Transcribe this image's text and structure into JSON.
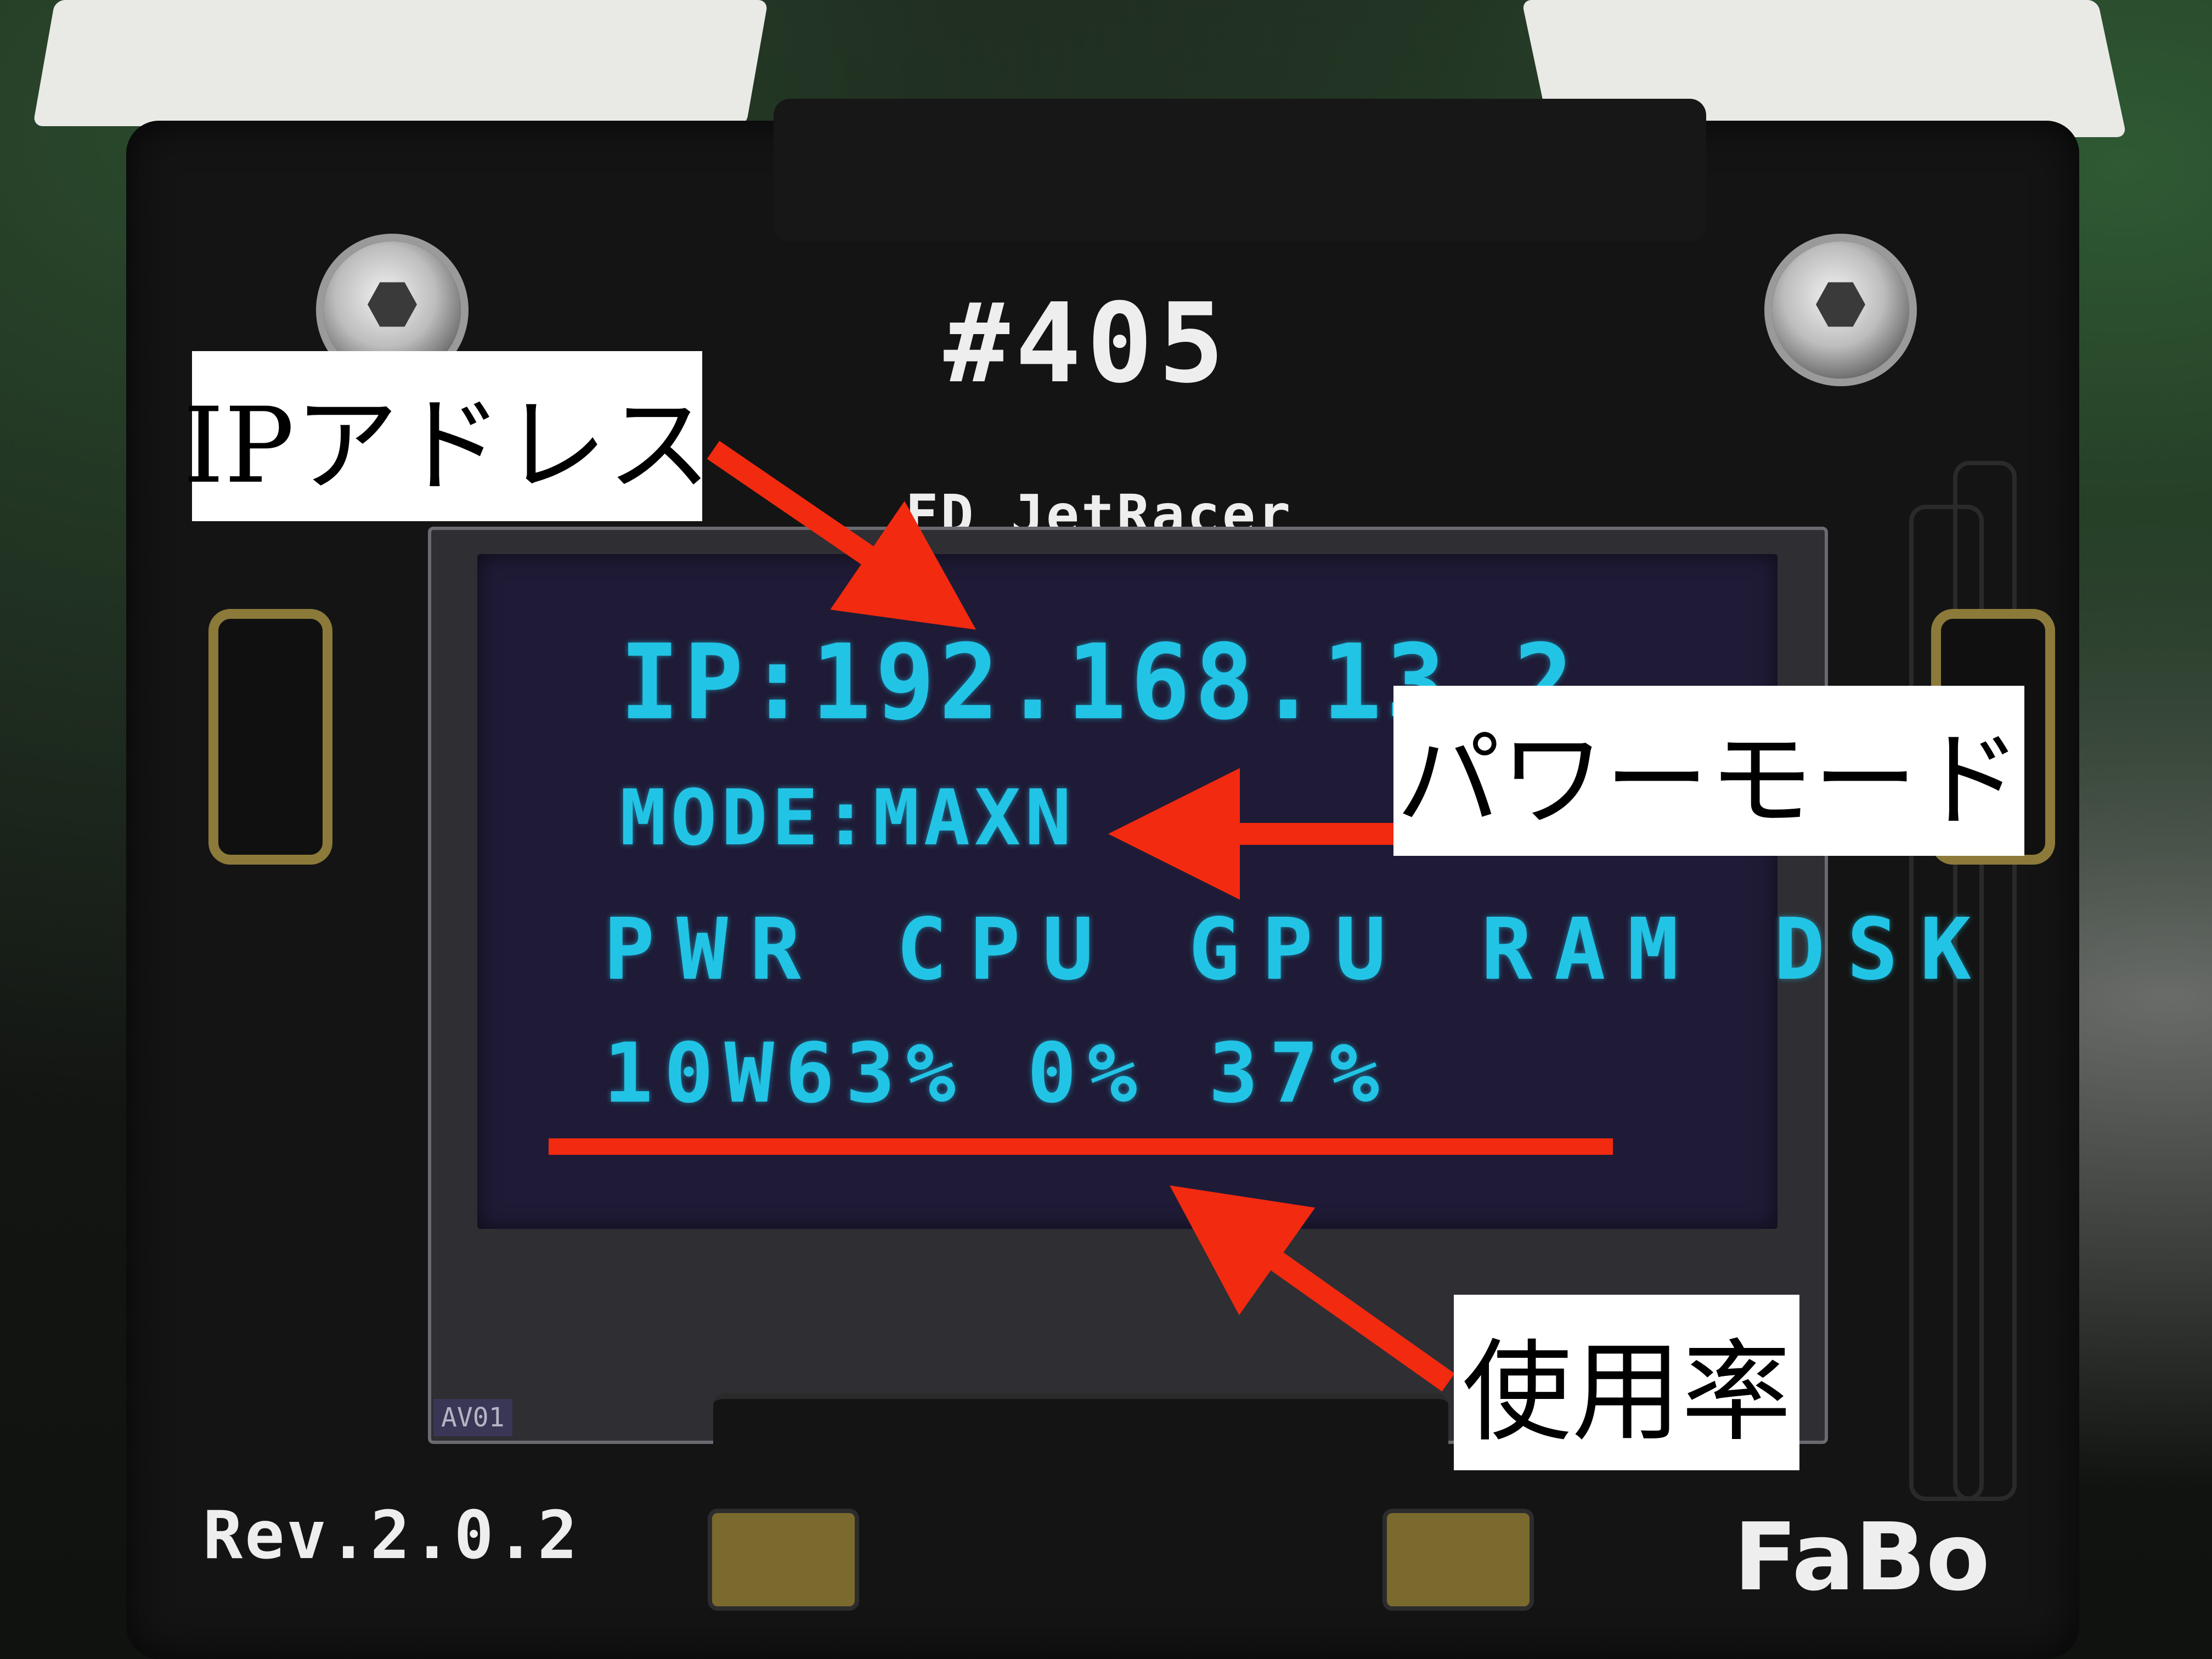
{
  "board": {
    "id_label": "#405",
    "name_label": "FD JetRacer",
    "revision_label": "Rev.2.0.2",
    "brand_label": "FaBo",
    "part_label": "AV01"
  },
  "oled": {
    "ip_line": "IP:192.168.13.2",
    "mode_line": "MODE:MAXN",
    "header_line": "PWR CPU GPU RAM DSK",
    "values_line": "10W63% 0% 37%",
    "text_color": "#22c4e6"
  },
  "annotations": {
    "ip_label": "IPアドレス",
    "mode_label": "パワーモード",
    "usage_label": "使用率",
    "arrow_color": "#f22a10"
  }
}
